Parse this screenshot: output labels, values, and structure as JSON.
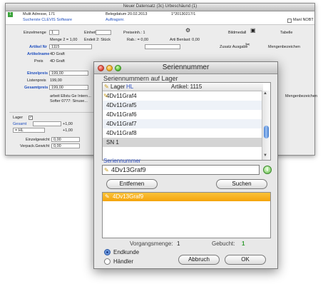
{
  "background_window": {
    "title": "Neuer Datensatz (3c) Urbeschäund (1)",
    "head": {
      "num_label": "1",
      "kunde": "Mulit Adresse, 171",
      "kunde2": "Sucherste CLEVIS Software",
      "belegdatum": "Belegdatum 20.02.2013",
      "auftragsnr": "Auftragsnr.",
      "beleg_nr": "1*20130217/1",
      "not_label": "Manl NOBT"
    },
    "rows": {
      "einzel_label": "Einzelmenge",
      "einzel_value": "1",
      "einheit_label": "Einheit",
      "preis_label": "Preiseinh.: 1",
      "menge_label": "Menge 2 = 1,00",
      "stueck_label": "Endeit 2: Stück",
      "rab_label": "Rab.: = 0,00",
      "beib_label": "Arti Benlast: 0,00",
      "bild_label": "Bildmedall",
      "tabelle_label": "Tabelle",
      "artikelnr_label": "Artikel Nr",
      "artikelnr_value": "1115",
      "artikelname_label": "Artikelname",
      "artikelname_value": "4D Graft",
      "preis2_label": "Preis",
      "preis2_value": "4D Graft",
      "einzelpreis_label": "Einzelpreis",
      "einzelpreis_value": "199,00",
      "listenpreis_label": "Listenpreis",
      "listenpreis_value": "199,00",
      "gesamtpreis_label": "Gesamtpreis",
      "gesamtpreis_value": "199,00",
      "zusatz_label": "Zusatz Ausgabe",
      "text1": "arbeit Ellstu Ge Intern...",
      "text2": "Softer 0777: Sinuse...",
      "lager_label": "Lager",
      "gesamt_label": "Gesamt",
      "hl_label": "= HL",
      "verpack_label": "Einzelgewicht",
      "verpack2_label": "Verpack.Gewicht",
      "val_a": "+1,00",
      "val_b": "+1,00",
      "val_c": "0,00",
      "val_d": "0,00",
      "right_label": "Mengenbezeichen"
    }
  },
  "dialog": {
    "title": "Seriennummer",
    "group_label": "Seriennummern auf Lager",
    "header_lager_label": "Lager",
    "header_lager_value": "HL",
    "header_artikel": "Artikel: 1115",
    "serials": [
      "4Dv11Graf4",
      "4Dv11Graf5",
      "4Dv11Graf6",
      "4Dv11Graf7",
      "4Dv11Graf8",
      "SN 1"
    ],
    "serial_field_label": "Seriennummer",
    "serial_field_value": "4Dv13Graf9",
    "remove_button": "Entfernen",
    "search_button": "Suchen",
    "selected_list": [
      "4Dv13Graf9"
    ],
    "vorgangsmenge_label": "Vorgangsmenge:",
    "vorgangsmenge_value": "1",
    "gebucht_label": "Gebucht:",
    "gebucht_value": "1",
    "radio_endkunde": "Endkunde",
    "radio_haendler": "Händler",
    "cancel_button": "Abbruch",
    "ok_button": "OK"
  },
  "colors": {
    "accent_blue": "#2e4fc0",
    "selection_orange": "#f4a40c",
    "gebucht_green": "#2e9a2e"
  }
}
